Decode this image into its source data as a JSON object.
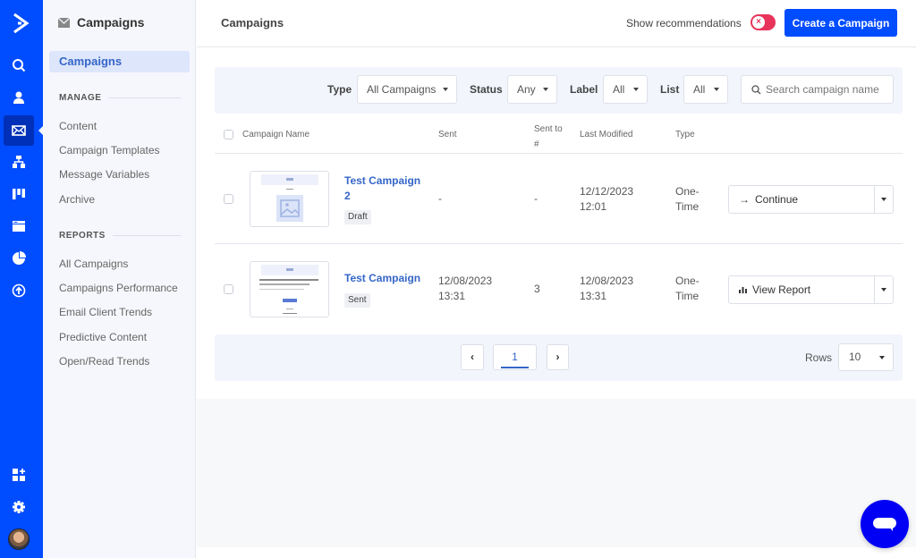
{
  "rail": {
    "icons": [
      "logo-icon",
      "search-icon",
      "contacts-icon",
      "campaigns-icon",
      "automations-icon",
      "pipelines-icon",
      "site-icon",
      "reports-icon",
      "upgrade-icon",
      "apps-icon",
      "settings-icon",
      "avatar"
    ],
    "active": "campaigns-icon"
  },
  "subnav": {
    "title": "Campaigns",
    "active_item": "Campaigns",
    "manage_heading": "MANAGE",
    "manage_items": [
      "Content",
      "Campaign Templates",
      "Message Variables",
      "Archive"
    ],
    "reports_heading": "REPORTS",
    "reports_items": [
      "All Campaigns",
      "Campaigns Performance",
      "Email Client Trends",
      "Predictive Content",
      "Open/Read Trends"
    ]
  },
  "header": {
    "title": "Campaigns",
    "recommendations_label": "Show recommendations",
    "recommendations_toggle": "off",
    "create_button": "Create a Campaign"
  },
  "filters": {
    "type_label": "Type",
    "type_value": "All Campaigns",
    "status_label": "Status",
    "status_value": "Any",
    "label_label": "Label",
    "label_value": "All",
    "list_label": "List",
    "list_value": "All",
    "search_placeholder": "Search campaign name"
  },
  "table": {
    "columns": [
      "Campaign Name",
      "Sent",
      "Sent to #",
      "Last Modified",
      "Type"
    ],
    "rows": [
      {
        "name": "Test Campaign 2",
        "status": "Draft",
        "sent": "-",
        "sent_to": "-",
        "last_modified_date": "12/12/2023",
        "last_modified_time": "12:01",
        "type": "One-Time",
        "action": "Continue",
        "action_icon": "arrow-right-icon"
      },
      {
        "name": "Test Campaign",
        "status": "Sent",
        "sent_date": "12/08/2023",
        "sent_time": "13:31",
        "sent_to": "3",
        "last_modified_date": "12/08/2023",
        "last_modified_time": "13:31",
        "type": "One-Time",
        "action": "View Report",
        "action_icon": "bar-chart-icon"
      }
    ]
  },
  "pagination": {
    "prev": "‹",
    "current_page": "1",
    "next": "›",
    "rows_label": "Rows",
    "rows_value": "10"
  },
  "colors": {
    "brand": "#004cff",
    "link": "#3566c8",
    "toggle_off": "#e8345a",
    "chat": "#0000f5"
  }
}
